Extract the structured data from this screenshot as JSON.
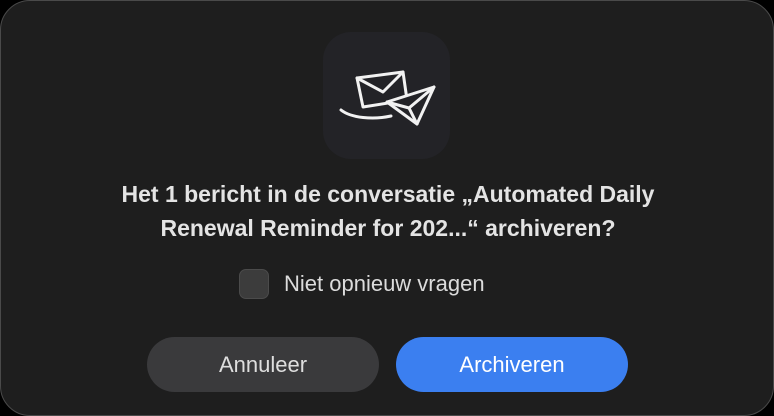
{
  "dialog": {
    "icon": "envelope-paper-plane-icon",
    "message_line1": "Het 1 bericht in de conversatie „Automated Daily",
    "message_line2": "Renewal Reminder for 202...“ archiveren?",
    "checkbox_label": "Niet opnieuw vragen",
    "checkbox_checked": false,
    "cancel_label": "Annuleer",
    "confirm_label": "Archiveren"
  },
  "colors": {
    "background": "#1e1e1e",
    "primary": "#3b7ff0",
    "secondary_button": "#3a3a3c"
  }
}
